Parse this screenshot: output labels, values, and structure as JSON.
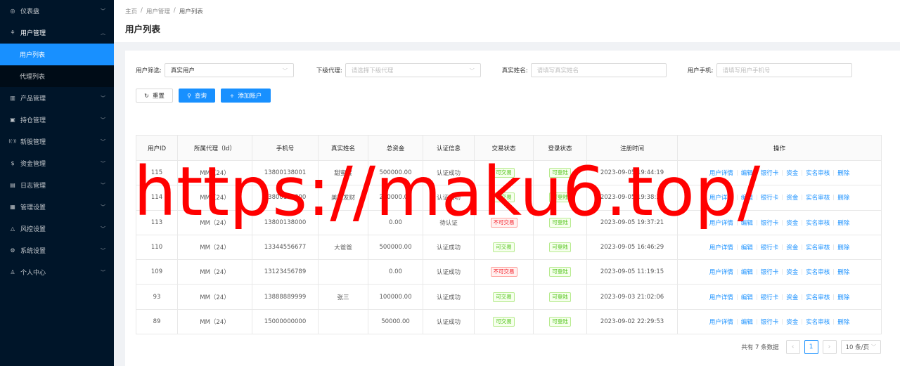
{
  "sidebar": {
    "items": [
      {
        "label": "仪表盘",
        "icon": "dashboard-icon"
      },
      {
        "label": "用户管理",
        "icon": "user-manage-icon",
        "open": true,
        "children": [
          {
            "label": "用户列表",
            "active": true
          },
          {
            "label": "代理列表"
          }
        ]
      },
      {
        "label": "产品管理",
        "icon": "chart-icon"
      },
      {
        "label": "持仓管理",
        "icon": "position-icon"
      },
      {
        "label": "新股管理",
        "icon": "signal-icon"
      },
      {
        "label": "资金管理",
        "icon": "money-icon"
      },
      {
        "label": "日志管理",
        "icon": "log-icon"
      },
      {
        "label": "管理设置",
        "icon": "settings-panel-icon"
      },
      {
        "label": "风控设置",
        "icon": "warning-icon"
      },
      {
        "label": "系统设置",
        "icon": "gear-icon"
      },
      {
        "label": "个人中心",
        "icon": "person-icon"
      }
    ]
  },
  "breadcrumb": [
    "主页",
    "用户管理",
    "用户列表"
  ],
  "page_title": "用户列表",
  "filters": {
    "user_filter_label": "用户筛选:",
    "user_filter_value": "真实用户",
    "agent_label": "下级代理:",
    "agent_placeholder": "请选择下级代理",
    "realname_label": "真实姓名:",
    "realname_placeholder": "请填写真实姓名",
    "phone_label": "用户手机:",
    "phone_placeholder": "请填写用户手机号"
  },
  "buttons": {
    "reset": "重置",
    "query": "查询",
    "add": "添加账户"
  },
  "table": {
    "columns": [
      "用户ID",
      "所属代理（Id）",
      "手机号",
      "真实姓名",
      "总资金",
      "认证信息",
      "交易状态",
      "登录状态",
      "注册时间",
      "操作"
    ],
    "rows": [
      {
        "id": "115",
        "agent": "MM（24）",
        "phone": "13800138001",
        "name": "甜蜜蜜",
        "funds": "500000.00",
        "auth": "认证成功",
        "trade": "可交易",
        "trade_ok": true,
        "login": "可登陆",
        "time": "2023-09-05 19:44:19"
      },
      {
        "id": "114",
        "agent": "MM（24）",
        "phone": "13800138000",
        "name": "美国发财",
        "funds": "250000.00",
        "auth": "认证成功",
        "trade": "可交易",
        "trade_ok": true,
        "login": "可登陆",
        "time": "2023-09-05 19:38:21"
      },
      {
        "id": "113",
        "agent": "MM（24）",
        "phone": "13800138000",
        "name": "",
        "funds": "0.00",
        "auth": "待认证",
        "trade": "不可交易",
        "trade_ok": false,
        "login": "可登陆",
        "time": "2023-09-05 19:37:21"
      },
      {
        "id": "110",
        "agent": "MM（24）",
        "phone": "13344556677",
        "name": "大爸爸",
        "funds": "500000.00",
        "auth": "认证成功",
        "trade": "可交易",
        "trade_ok": true,
        "login": "可登陆",
        "time": "2023-09-05 16:46:29"
      },
      {
        "id": "109",
        "agent": "MM（24）",
        "phone": "13123456789",
        "name": "",
        "funds": "0.00",
        "auth": "认证成功",
        "trade": "不可交易",
        "trade_ok": false,
        "login": "可登陆",
        "time": "2023-09-05 11:19:15"
      },
      {
        "id": "93",
        "agent": "MM（24）",
        "phone": "13888889999",
        "name": "张三",
        "funds": "100000.00",
        "auth": "认证成功",
        "trade": "可交易",
        "trade_ok": true,
        "login": "可登陆",
        "time": "2023-09-03 21:02:06"
      },
      {
        "id": "89",
        "agent": "MM（24）",
        "phone": "15000000000",
        "name": "",
        "funds": "50000.00",
        "auth": "认证成功",
        "trade": "可交易",
        "trade_ok": true,
        "login": "可登陆",
        "time": "2023-09-02 22:29:53"
      }
    ],
    "ops": [
      "用户详情",
      "编辑",
      "银行卡",
      "资金",
      "实名审核",
      "删除"
    ]
  },
  "pagination": {
    "total": "共有 7 条数据",
    "current": "1",
    "page_size": "10 条/页"
  },
  "watermark": "https://maku6.top/",
  "colors": {
    "sidebar_bg": "#001529",
    "primary": "#1890ff",
    "watermark": "#ff0000"
  }
}
